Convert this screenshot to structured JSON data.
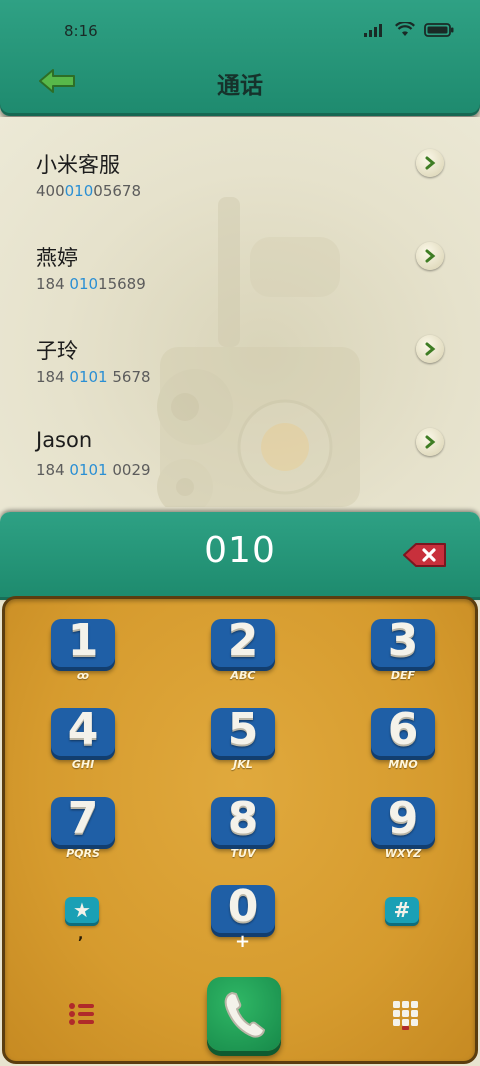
{
  "status_bar": {
    "time": "8:16"
  },
  "header": {
    "title": "通话",
    "back_icon": "arrow-left-icon"
  },
  "contacts": [
    {
      "name": "小米客服",
      "number_pre": "400",
      "number_match": "010",
      "number_post": "05678"
    },
    {
      "name": "燕婷",
      "number_pre": "184 ",
      "number_match": "010",
      "number_post": "15689"
    },
    {
      "name": "子玲",
      "number_pre": "184 ",
      "number_match": "0101",
      "number_post": " 5678"
    },
    {
      "name": "Jason",
      "number_pre": "184 ",
      "number_match": "0101",
      "number_post": " 0029"
    }
  ],
  "dialer": {
    "display_number": "010",
    "delete_icon": "backspace-icon"
  },
  "keypad": {
    "keys": [
      {
        "digit": "1",
        "sub": "ꝏ"
      },
      {
        "digit": "2",
        "sub": "ABC"
      },
      {
        "digit": "3",
        "sub": "DEF"
      },
      {
        "digit": "4",
        "sub": "GHI"
      },
      {
        "digit": "5",
        "sub": "JKL"
      },
      {
        "digit": "6",
        "sub": "MNO"
      },
      {
        "digit": "7",
        "sub": "PQRS"
      },
      {
        "digit": "8",
        "sub": "TUV"
      },
      {
        "digit": "9",
        "sub": "WXYZ"
      }
    ],
    "star": {
      "symbol": "★",
      "sub": ","
    },
    "zero": {
      "digit": "0",
      "sub": "+"
    },
    "hash": {
      "symbol": "#"
    }
  },
  "colors": {
    "header": "#1e8a6e",
    "keypad": "#d69b2e",
    "key": "#1f5fa6",
    "highlight": "#2a8fd4",
    "call": "#17894a"
  }
}
